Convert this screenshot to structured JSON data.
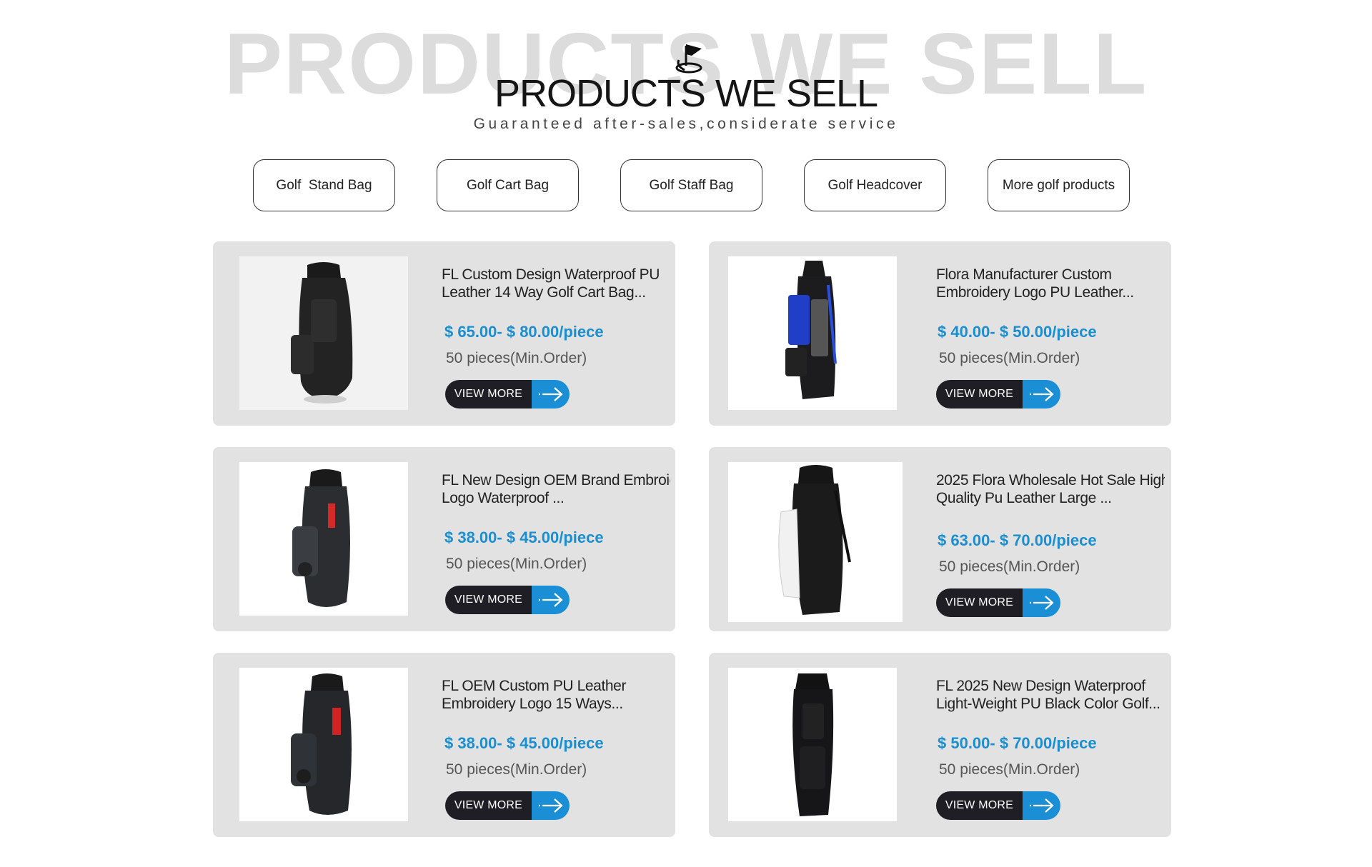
{
  "header": {
    "background_title": "PRODUCTS WE SELL",
    "title": "PRODUCTS WE SELL",
    "subtitle": "Guaranteed after-sales,considerate service"
  },
  "tabs": [
    {
      "label": "Golf  Stand Bag"
    },
    {
      "label": "Golf Cart Bag"
    },
    {
      "label": "Golf Staff Bag"
    },
    {
      "label": "Golf Headcover"
    },
    {
      "label": "More golf products"
    }
  ],
  "products": [
    {
      "title_line1": "FL Custom Design Waterproof PU",
      "title_line2": "Leather 14 Way Golf Cart Bag...",
      "price": "$ 65.00- $ 80.00/piece",
      "moq": "50 pieces(Min.Order)",
      "button": "VIEW MORE",
      "image_icon": "black-golf-cart-bag-icon"
    },
    {
      "title_line1": "Flora Manufacturer Custom",
      "title_line2": "Embroidery Logo PU Leather...",
      "price": "$ 40.00- $ 50.00/piece",
      "moq": "50 pieces(Min.Order)",
      "button": "VIEW MORE",
      "image_icon": "blue-black-golf-cart-bag-icon"
    },
    {
      "title_line1": "FL New Design OEM Brand Embroidery",
      "title_line2": "Logo Waterproof ...",
      "price": "$ 38.00- $ 45.00/piece",
      "moq": "50 pieces(Min.Order)",
      "button": "VIEW MORE",
      "image_icon": "grey-red-golf-cart-bag-icon"
    },
    {
      "title_line1": "2025 Flora Wholesale Hot Sale High",
      "title_line2": "Quality Pu Leather Large ...",
      "price": "$ 63.00- $ 70.00/piece",
      "moq": "50 pieces(Min.Order)",
      "button": "VIEW MORE",
      "image_icon": "black-white-golf-cart-bag-icon"
    },
    {
      "title_line1": "FL OEM Custom PU Leather",
      "title_line2": "Embroidery Logo 15 Ways...",
      "price": "$ 38.00- $ 45.00/piece",
      "moq": "50 pieces(Min.Order)",
      "button": "VIEW MORE",
      "image_icon": "black-red-golf-cart-bag-icon"
    },
    {
      "title_line1": "FL 2025 New Design Waterproof",
      "title_line2": "Light-Weight PU Black Color Golf...",
      "price": "$ 50.00- $ 70.00/piece",
      "moq": "50 pieces(Min.Order)",
      "button": "VIEW MORE",
      "image_icon": "black-staff-golf-bag-icon"
    }
  ],
  "colors": {
    "price": "#1a8ed1",
    "button_dark": "#1e1e24",
    "button_arrow": "#1b8fd6",
    "card_bg": "#e2e2e2",
    "bg_title": "#dcdcdc"
  }
}
